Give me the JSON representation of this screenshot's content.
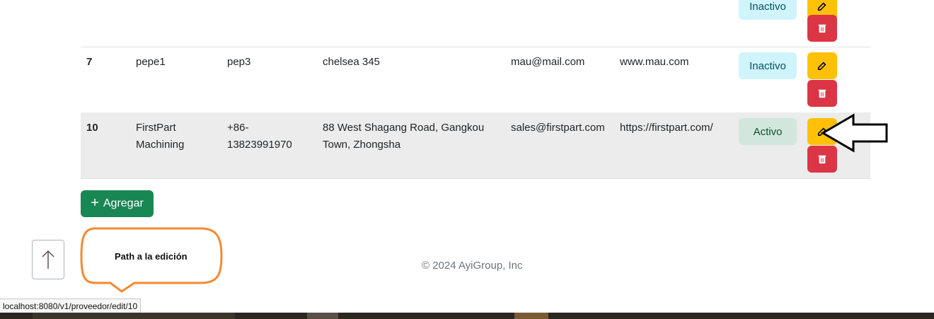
{
  "rows": [
    {
      "id": "",
      "name": "",
      "phone": "",
      "address": "",
      "email": "",
      "web": "",
      "status": "Inactivo"
    },
    {
      "id": "7",
      "name": "pepe1",
      "phone": "pep3",
      "address": "chelsea 345",
      "email": "mau@mail.com",
      "web": "www.mau.com",
      "status": "Inactivo"
    },
    {
      "id": "10",
      "name": "FirstPart Machining",
      "phone": "+86-13823991970",
      "address": "88 West Shagang Road, Gangkou Town, Zhongsha",
      "email": "sales@firstpart.com",
      "web": "https://firstpart.com/",
      "status": "Activo"
    }
  ],
  "actions": {
    "edit_icon": "edit-icon",
    "delete_icon": "trash-icon"
  },
  "add_button": {
    "label": "Agregar",
    "icon": "plus-icon"
  },
  "scroll_top": {
    "icon": "arrow-up-icon"
  },
  "footer": {
    "text": "© 2024 AyiGroup, Inc"
  },
  "annotation": {
    "text": "Path a la edición"
  },
  "status_bar": {
    "url": "localhost:8080/v1/proveedor/edit/10"
  },
  "colors": {
    "warning": "#ffc107",
    "danger": "#dc3545",
    "success": "#198754",
    "info_bg": "#cff4fc",
    "success_bg": "#d1e7dd",
    "callout": "#f4892f"
  }
}
